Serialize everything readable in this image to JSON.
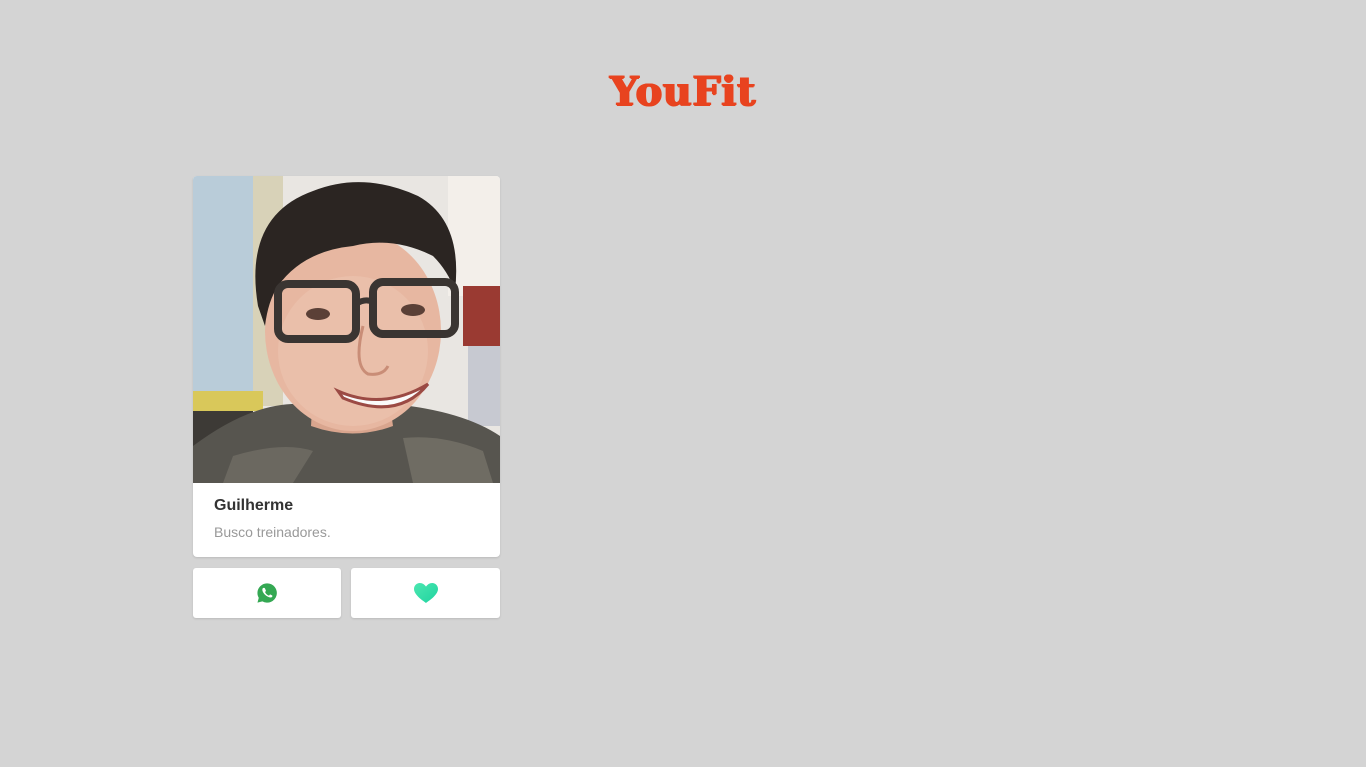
{
  "header": {
    "logo_text": "YouFit"
  },
  "profile": {
    "name": "Guilherme",
    "bio": "Busco treinadores.",
    "photo_alt": "Guilherme"
  },
  "actions": {
    "whatsapp_icon": "whatsapp-icon",
    "like_icon": "heart-icon"
  },
  "colors": {
    "background": "#d4d4d4",
    "brand": "#e8431f",
    "whatsapp": "#34a853",
    "like": "#34e5a1"
  }
}
